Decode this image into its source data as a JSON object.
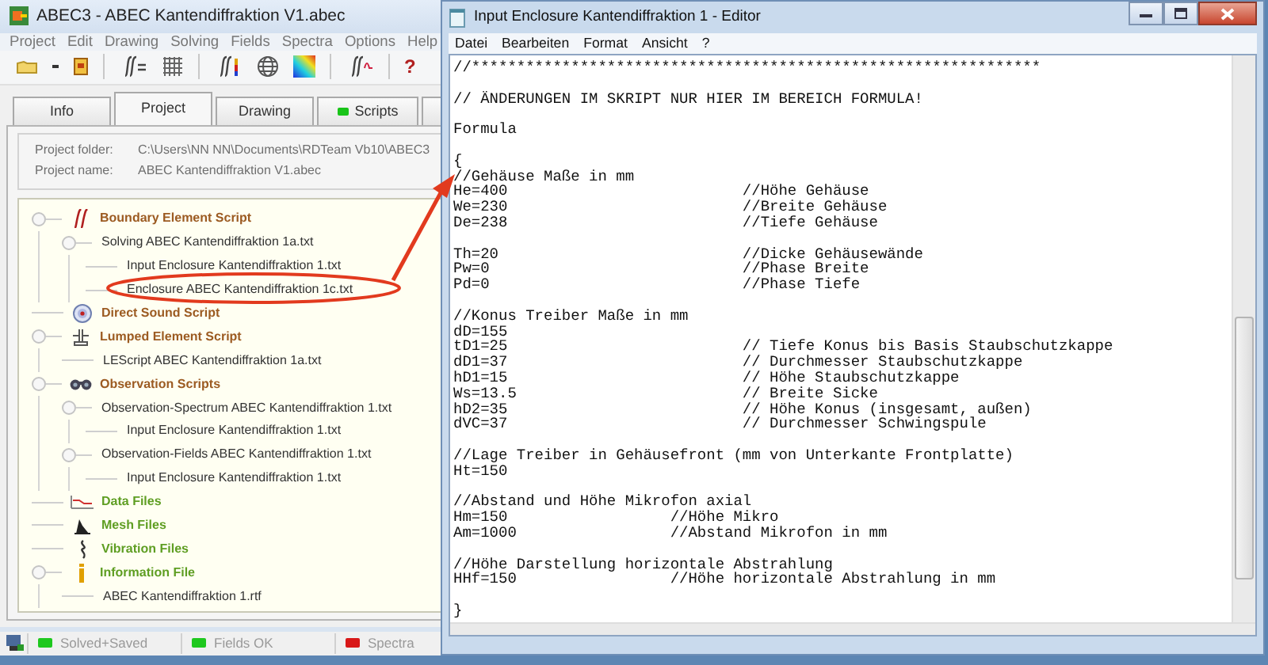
{
  "app_window": {
    "title": "ABEC3 - ABEC Kantendiffraktion V1.abec",
    "menu": [
      "Project",
      "Edit",
      "Drawing",
      "Solving",
      "Fields",
      "Spectra",
      "Options",
      "Help"
    ],
    "toolbar": {
      "help": "?"
    },
    "tabs": [
      {
        "label": "Info",
        "selected": false
      },
      {
        "label": "Project",
        "selected": true
      },
      {
        "label": "Drawing",
        "selected": false
      },
      {
        "label": "Scripts",
        "selected": false,
        "color": "#19c419"
      },
      {
        "selected": false
      }
    ],
    "project_info": [
      {
        "label": "Project folder:",
        "value": "C:\\Users\\NN NN\\Documents\\RDTeam Vb10\\ABEC3"
      },
      {
        "label": "Project name:",
        "value": "ABEC Kantendiffraktion V1.abec"
      }
    ],
    "tree": [
      {
        "label": "Boundary Element Script",
        "kind": "boundary",
        "color": "#9c5b22",
        "expanded": true,
        "children": [
          {
            "label": "Solving ABEC Kantendiffraktion 1a.txt",
            "expanded": true,
            "children": [
              {
                "label": "Input Enclosure Kantendiffraktion 1.txt"
              },
              {
                "label": "Enclosure ABEC Kantendiffraktion 1c.txt"
              }
            ]
          }
        ]
      },
      {
        "label": "Direct Sound Script",
        "kind": "direct",
        "color": "#9c5b22"
      },
      {
        "label": "Lumped Element Script",
        "kind": "lumped",
        "color": "#9c5b22",
        "expanded": true,
        "children": [
          {
            "label": "LEScript ABEC Kantendiffraktion 1a.txt"
          }
        ]
      },
      {
        "label": "Observation Scripts",
        "kind": "observation",
        "color": "#9c5b22",
        "expanded": true,
        "children": [
          {
            "label": "Observation-Spectrum ABEC Kantendiffraktion 1.txt",
            "expanded": true,
            "children": [
              {
                "label": "Input Enclosure Kantendiffraktion 1.txt"
              }
            ]
          },
          {
            "label": "Observation-Fields ABEC Kantendiffraktion 1.txt",
            "expanded": true,
            "children": [
              {
                "label": "Input Enclosure Kantendiffraktion 1.txt"
              }
            ]
          }
        ]
      },
      {
        "label": "Data Files",
        "kind": "data",
        "color": "#5f9e23"
      },
      {
        "label": "Mesh Files",
        "kind": "mesh",
        "color": "#5f9e23"
      },
      {
        "label": "Vibration Files",
        "kind": "vibration",
        "color": "#5f9e23"
      },
      {
        "label": "Information File",
        "kind": "info",
        "color": "#5f9e23",
        "expanded": true,
        "children": [
          {
            "label": "ABEC Kantendiffraktion 1.rtf"
          }
        ]
      }
    ],
    "status_bar": [
      {
        "label": "Solved+Saved",
        "color": "#1ec81e"
      },
      {
        "label": "Fields OK",
        "color": "#1ec81e"
      },
      {
        "label": "Spectra",
        "color": "#d81818"
      }
    ]
  },
  "editor_window": {
    "title": "Input Enclosure Kantendiffraktion 1 - Editor",
    "menu": [
      "Datei",
      "Bearbeiten",
      "Format",
      "Ansicht",
      "?"
    ],
    "blocks": [
      [
        "//***************************************************************"
      ],
      [
        "// ÄNDERUNGEN IM SKRIPT NUR HIER IM BEREICH FORMULA!"
      ],
      [
        "Formula"
      ],
      [
        "{",
        "//Gehäuse Maße in mm",
        "He=400                          //Höhe Gehäuse",
        "We=230                          //Breite Gehäuse",
        "De=238                          //Tiefe Gehäuse"
      ],
      [
        "Th=20                           //Dicke Gehäusewände",
        "Pw=0                            //Phase Breite",
        "Pd=0                            //Phase Tiefe"
      ],
      [
        "//Konus Treiber Maße in mm",
        "dD=155",
        "tD1=25                          // Tiefe Konus bis Basis Staubschutzkappe",
        "dD1=37                          // Durchmesser Staubschutzkappe",
        "hD1=15                          // Höhe Staubschutzkappe",
        "Ws=13.5                         // Breite Sicke",
        "hD2=35                          // Höhe Konus (insgesamt, außen)",
        "dVC=37                          // Durchmesser Schwingspule"
      ],
      [
        "//Lage Treiber in Gehäusefront (mm von Unterkante Frontplatte)",
        "Ht=150"
      ],
      [
        "//Abstand und Höhe Mikrofon axial",
        "Hm=150                  //Höhe Mikro",
        "Am=1000                 //Abstand Mikrofon in mm"
      ],
      [
        "//Höhe Darstellung horizontale Abstrahlung",
        "HHf=150                 //Höhe horizontale Abstrahlung in mm"
      ],
      [
        "}"
      ]
    ]
  }
}
